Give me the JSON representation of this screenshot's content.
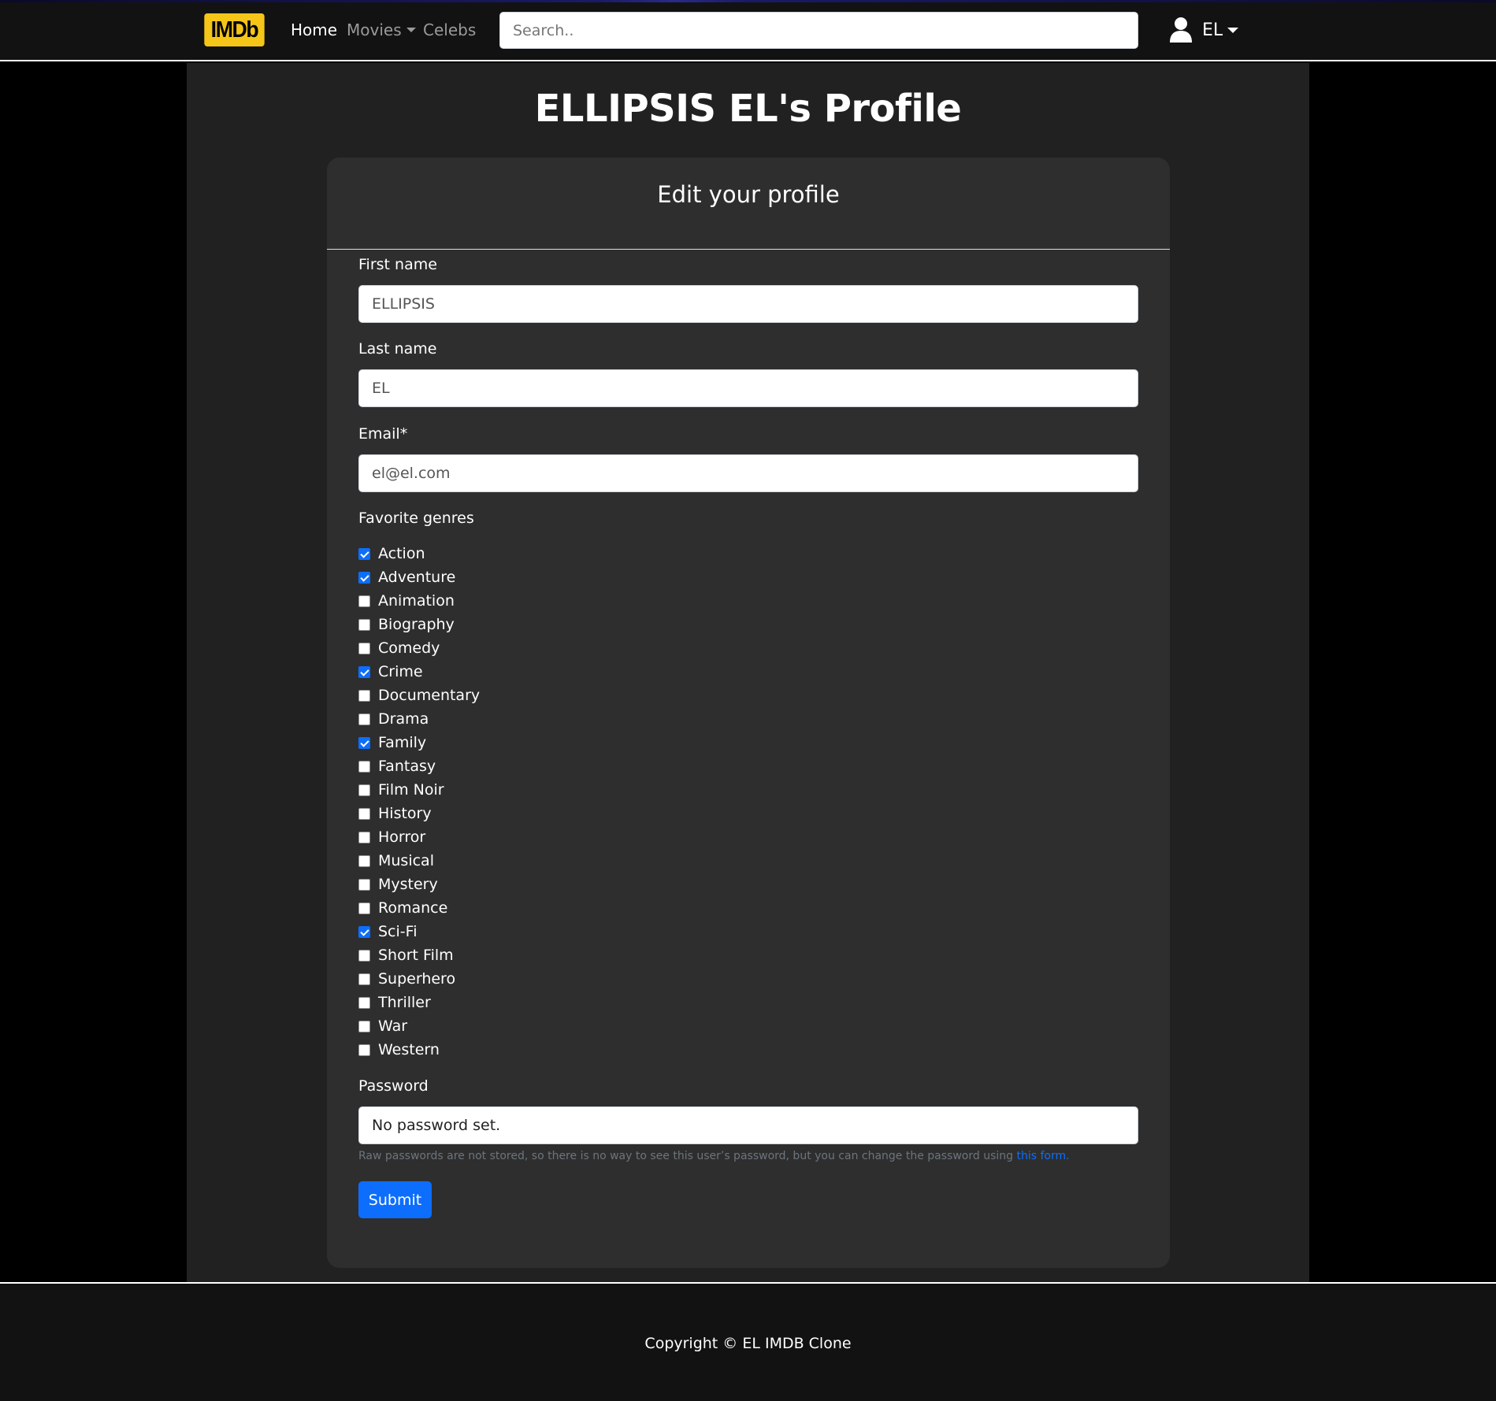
{
  "navbar": {
    "logo_text": "IMDb",
    "links": {
      "home": "Home",
      "movies": "Movies",
      "celebs": "Celebs"
    },
    "search_placeholder": "Search..",
    "user_initials": "EL"
  },
  "page": {
    "title": "ELLIPSIS EL's Profile"
  },
  "form": {
    "card_title": "Edit your profile",
    "first_name_label": "First name",
    "first_name_value": "ELLIPSIS",
    "last_name_label": "Last name",
    "last_name_value": "EL",
    "email_label": "Email*",
    "email_value": "el@el.com",
    "genres_label": "Favorite genres",
    "genres": [
      {
        "label": "Action",
        "checked": true
      },
      {
        "label": "Adventure",
        "checked": true
      },
      {
        "label": "Animation",
        "checked": false
      },
      {
        "label": "Biography",
        "checked": false
      },
      {
        "label": "Comedy",
        "checked": false
      },
      {
        "label": "Crime",
        "checked": true
      },
      {
        "label": "Documentary",
        "checked": false
      },
      {
        "label": "Drama",
        "checked": false
      },
      {
        "label": "Family",
        "checked": true
      },
      {
        "label": "Fantasy",
        "checked": false
      },
      {
        "label": "Film Noir",
        "checked": false
      },
      {
        "label": "History",
        "checked": false
      },
      {
        "label": "Horror",
        "checked": false
      },
      {
        "label": "Musical",
        "checked": false
      },
      {
        "label": "Mystery",
        "checked": false
      },
      {
        "label": "Romance",
        "checked": false
      },
      {
        "label": "Sci-Fi",
        "checked": true
      },
      {
        "label": "Short Film",
        "checked": false
      },
      {
        "label": "Superhero",
        "checked": false
      },
      {
        "label": "Thriller",
        "checked": false
      },
      {
        "label": "War",
        "checked": false
      },
      {
        "label": "Western",
        "checked": false
      }
    ],
    "password_label": "Password",
    "password_value": "No password set.",
    "password_help": "Raw passwords are not stored, so there is no way to see this user’s password, but you can change the password using ",
    "password_help_link": "this form",
    "password_help_end": ".",
    "submit_label": "Submit"
  },
  "footer": {
    "copyright": "Copyright © EL IMDB Clone"
  },
  "colors": {
    "accent": "#0d6efd",
    "logo_bg": "#f5c518",
    "card_bg": "#2e2e2e",
    "page_bg": "#212121"
  }
}
